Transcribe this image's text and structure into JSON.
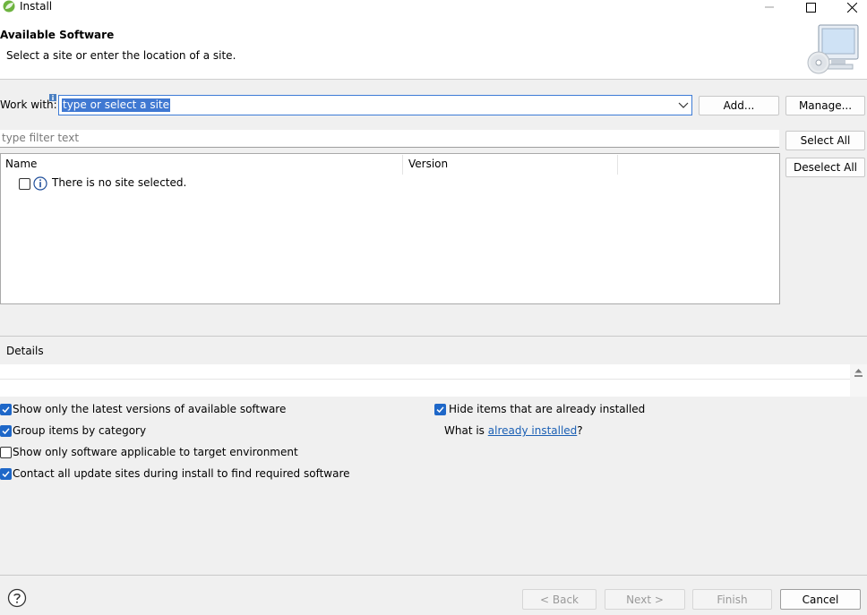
{
  "window": {
    "title": "Install",
    "icon": "spring-leaf-icon",
    "controls": [
      "minimize-icon",
      "maximize-icon",
      "close-icon"
    ]
  },
  "banner": {
    "title": "Available Software",
    "description": "Select a site or enter the location of a site.",
    "image": "computer-cd-icon"
  },
  "work_with": {
    "label": "Work with:",
    "value": "type or select a site",
    "add_label": "Add...",
    "manage_label": "Manage..."
  },
  "filter": {
    "placeholder": "type filter text"
  },
  "actions": {
    "select_all_label": "Select All",
    "deselect_all_label": "Deselect All"
  },
  "table": {
    "columns": [
      "Name",
      "Version"
    ],
    "rows": [
      {
        "checked": false,
        "icon": "info-icon",
        "name": "There is no site selected."
      }
    ]
  },
  "details": {
    "label": "Details",
    "text": ""
  },
  "options": {
    "show_latest": {
      "label": "Show only the latest versions of available software",
      "checked": true
    },
    "group_by_category": {
      "label": "Group items by category",
      "checked": true
    },
    "show_applicable": {
      "label": "Show only software applicable to target environment",
      "checked": false
    },
    "contact_all_sites": {
      "label": "Contact all update sites during install to find required software",
      "checked": true
    },
    "hide_installed": {
      "label": "Hide items that are already installed",
      "checked": true
    },
    "what_is_prefix": "What is ",
    "already_installed_link": "already installed",
    "what_is_suffix": "?"
  },
  "footer": {
    "help_icon": "help-icon",
    "back_label": "< Back",
    "next_label": "Next >",
    "finish_label": "Finish",
    "cancel_label": "Cancel"
  },
  "colors": {
    "accent": "#1e67c8",
    "selection": "#3f78d2",
    "link": "#1a5fb4",
    "disabled_text": "#9a9a9a"
  }
}
